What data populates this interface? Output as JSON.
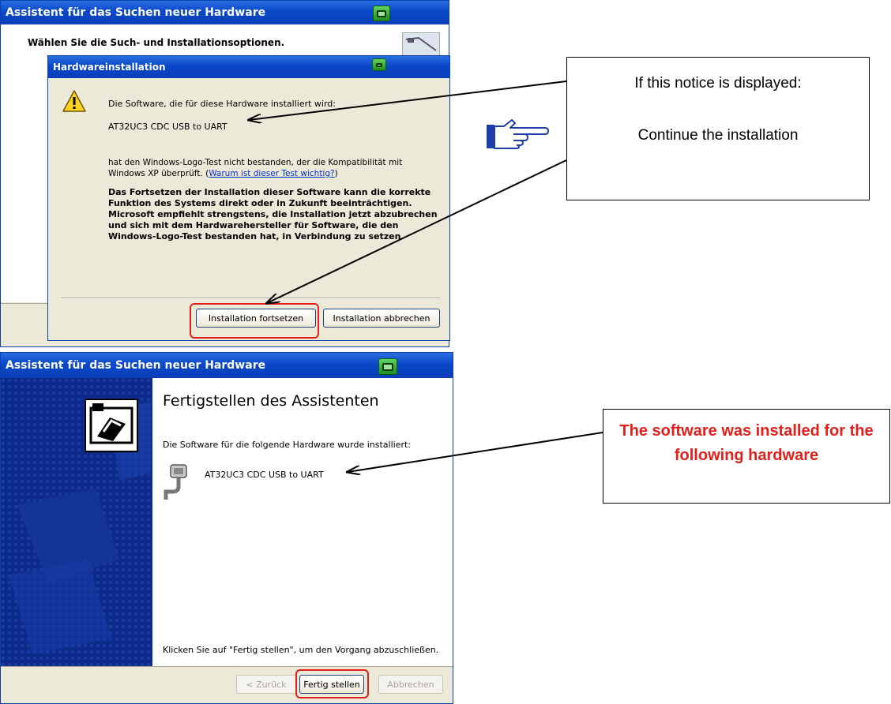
{
  "top_wizard": {
    "title": "Assistent für das Suchen neuer Hardware",
    "header": "Wählen Sie die Such- und Installationsoptionen."
  },
  "hw_dialog": {
    "title": "Hardwareinstallation",
    "line1": "Die Software, die für diese Hardware installiert wird:",
    "device": "AT32UC3 CDC USB to UART",
    "para1_a": "hat den Windows-Logo-Test nicht bestanden, der die Kompatibilität mit",
    "para1_b": "Windows XP überprüft. (",
    "para1_link": "Warum ist dieser Test wichtig?",
    "para1_c": ")",
    "warning": [
      "Das Fortsetzen der Installation dieser Software kann die korrekte",
      "Funktion des Systems direkt oder in Zukunft beeinträchtigen.",
      "Microsoft empfiehlt strengstens, die Installation jetzt abzubrechen",
      "und sich mit dem Hardwarehersteller für Software, die den",
      "Windows-Logo-Test bestanden hat, in Verbindung zu setzen."
    ],
    "continue_label": "Installation fortsetzen",
    "cancel_label": "Installation abbrechen"
  },
  "bottom_wizard": {
    "title": "Assistent für das Suchen neuer Hardware",
    "heading": "Fertigstellen des Assistenten",
    "installed_text": "Die Software für die folgende Hardware wurde installiert:",
    "device": "AT32UC3 CDC USB to UART",
    "finish_text": "Klicken Sie auf \"Fertig stellen\", um den Vorgang abzuschließen.",
    "back_label": "< Zurück",
    "finish_label": "Fertig stellen",
    "cancel_label": "Abbrechen"
  },
  "callout1": {
    "line1": "If this notice is displayed:",
    "line2": "Continue the installation"
  },
  "callout2": {
    "text": "The software was installed for the following hardware",
    "color": "#e1201c"
  },
  "colors": {
    "xp_blue": "#0a47c8",
    "dialog_bg": "#ece9d8",
    "wizard_side": "#0b2a8a",
    "highlight": "#e1201c"
  }
}
